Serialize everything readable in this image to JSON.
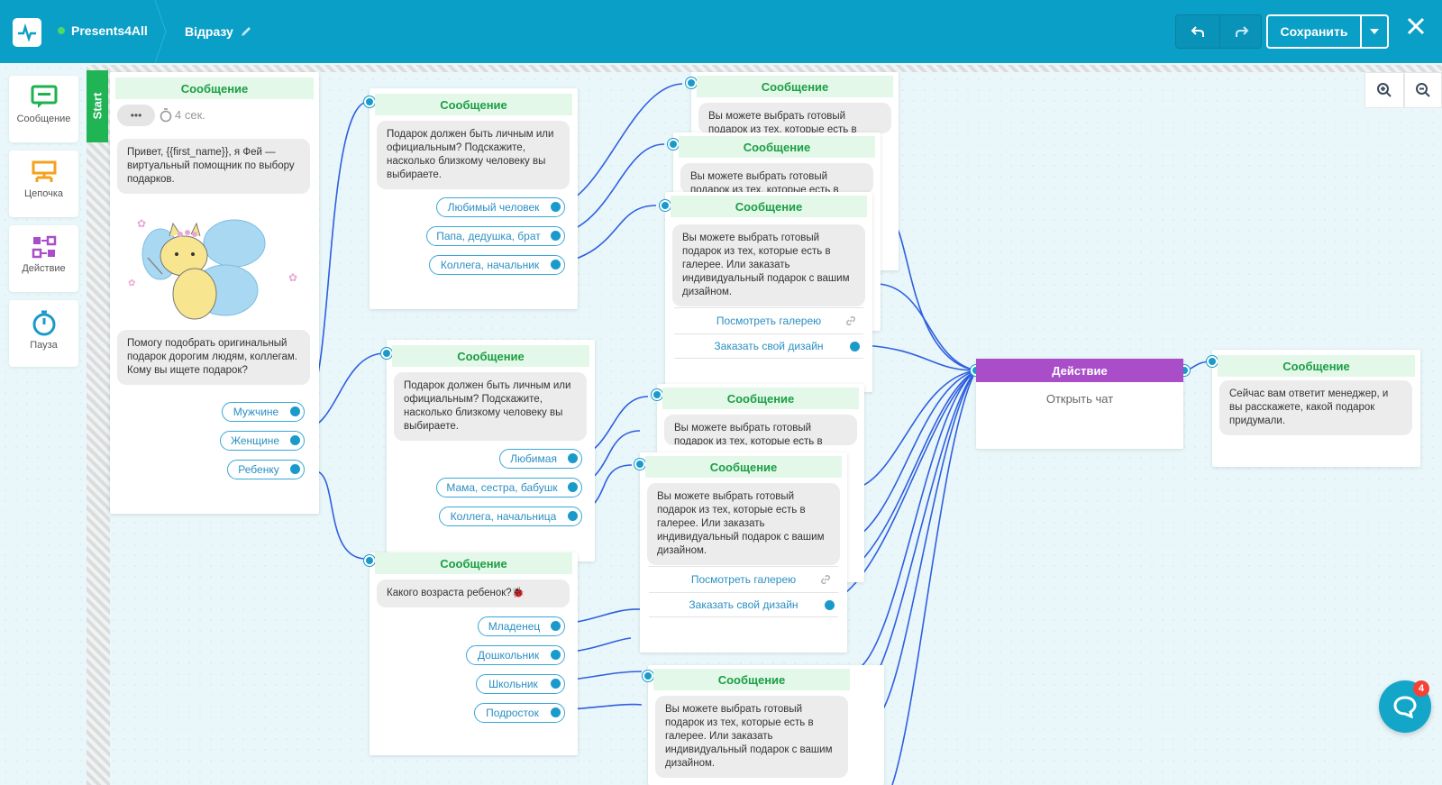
{
  "header": {
    "bot_name": "Presents4All",
    "flow_name": "Відразу",
    "save_label": "Сохранить"
  },
  "sidebar": {
    "items": [
      {
        "label": "Сообщение",
        "icon": "message-icon",
        "color": "#1bb24f"
      },
      {
        "label": "Цепочка",
        "icon": "chain-icon",
        "color": "#f3a21e"
      },
      {
        "label": "Действие",
        "icon": "action-icon",
        "color": "#a94ec8"
      },
      {
        "label": "Пауза",
        "icon": "timer-icon",
        "color": "#1a9acb"
      }
    ]
  },
  "start_label": "Start",
  "node_title": "Сообщение",
  "action_title": "Действие",
  "nodes": {
    "start": {
      "typing": "•••",
      "delay": "4 сек.",
      "text1": "Привет,  {{first_name}}, я Фей — виртуальный помощник по выбору подарков.",
      "text2": "Помогу подобрать оригинальный подарок дорогим людям, коллегам. Кому вы ищете подарок?",
      "buttons": [
        "Мужчине",
        "Женщине",
        "Ребенку"
      ]
    },
    "men": {
      "text": "Подарок должен быть личным или официальным? Подскажите, насколько близкому человеку вы выбираете.",
      "buttons": [
        "Любимый человек",
        "Папа, дедушка, брат",
        "Коллега, начальник"
      ]
    },
    "women": {
      "text": "Подарок должен быть личным или официальным? Подскажите, насколько близкому человеку вы выбираете.",
      "buttons": [
        "Любимая",
        "Мама, сестра, бабушк",
        "Коллега, начальница"
      ]
    },
    "child": {
      "text": "Какого возраста ребенок?🐞",
      "buttons": [
        "Младенец",
        "Дошкольник",
        "Школьник",
        "Подросток"
      ]
    },
    "gallery": {
      "short": "Вы можете выбрать готовый подарок из тех, которые есть в",
      "full": "Вы можете выбрать готовый подарок из тех, которые есть в галерее. Или заказать индивидуальный подарок с вашим дизайном.",
      "btn_gallery": "Посмотреть галерею",
      "btn_design": "Заказать свой дизайн"
    },
    "action": {
      "text": "Открыть чат"
    },
    "final": {
      "text": "Сейчас вам ответит менеджер, и вы расскажете, какой подарок придумали."
    }
  },
  "chat_badge": "4",
  "colors": {
    "header": "#0a9fc6",
    "wire": "#2f5fe0",
    "port": "#1a9acb",
    "node_header": "#e3f8e8",
    "action": "#a94ec8"
  }
}
